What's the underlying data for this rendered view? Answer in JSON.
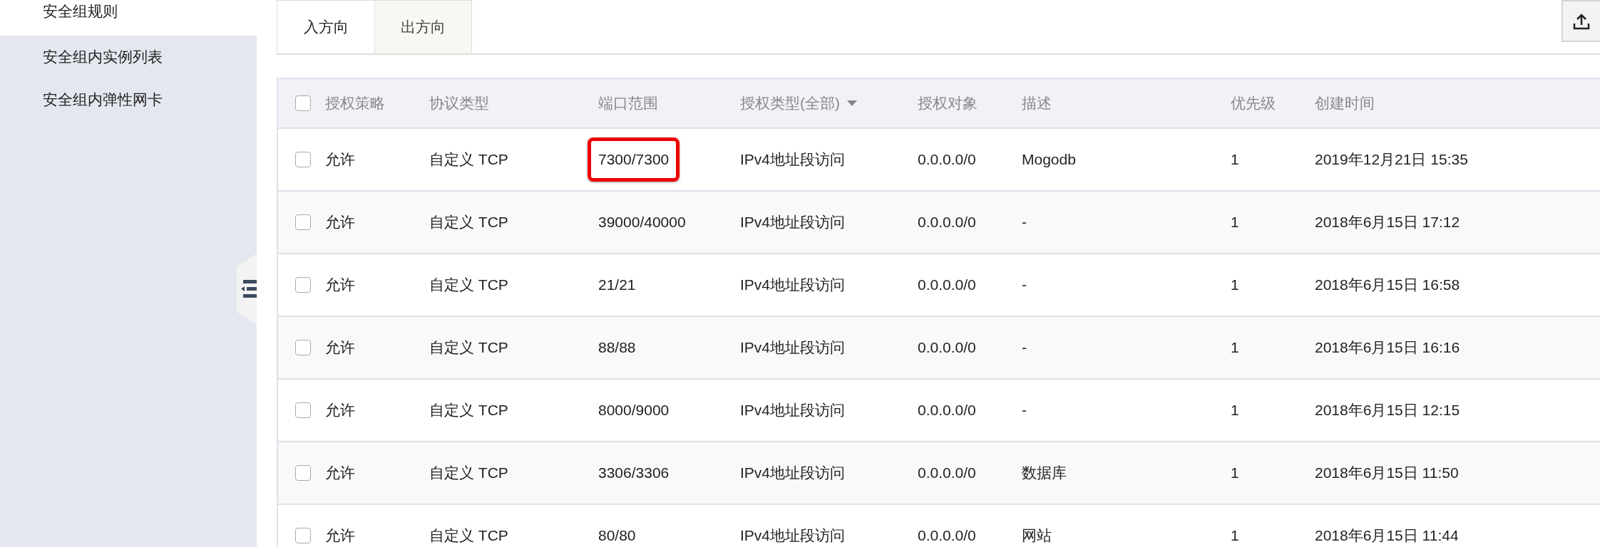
{
  "sidebar": {
    "items": [
      {
        "label": "安全组规则",
        "selected": true
      },
      {
        "label": "安全组内实例列表",
        "selected": false
      },
      {
        "label": "安全组内弹性网卡",
        "selected": false
      }
    ]
  },
  "tabs": [
    {
      "label": "入方向",
      "selected": true
    },
    {
      "label": "出方向",
      "selected": false
    }
  ],
  "table": {
    "columns": [
      "授权策略",
      "协议类型",
      "端口范围",
      "授权类型(全部)",
      "授权对象",
      "描述",
      "优先级",
      "创建时间"
    ],
    "select_all_checked": false,
    "rows": [
      {
        "checked": false,
        "highlighted": true,
        "cells": [
          "允许",
          "自定义 TCP",
          "7300/7300",
          "IPv4地址段访问",
          "0.0.0.0/0",
          "Mogodb",
          "1",
          "2019年12月21日 15:35"
        ]
      },
      {
        "checked": false,
        "highlighted": false,
        "cells": [
          "允许",
          "自定义 TCP",
          "39000/40000",
          "IPv4地址段访问",
          "0.0.0.0/0",
          "-",
          "1",
          "2018年6月15日 17:12"
        ]
      },
      {
        "checked": false,
        "highlighted": false,
        "cells": [
          "允许",
          "自定义 TCP",
          "21/21",
          "IPv4地址段访问",
          "0.0.0.0/0",
          "-",
          "1",
          "2018年6月15日 16:58"
        ]
      },
      {
        "checked": false,
        "highlighted": false,
        "cells": [
          "允许",
          "自定义 TCP",
          "88/88",
          "IPv4地址段访问",
          "0.0.0.0/0",
          "-",
          "1",
          "2018年6月15日 16:16"
        ]
      },
      {
        "checked": false,
        "highlighted": false,
        "cells": [
          "允许",
          "自定义 TCP",
          "8000/9000",
          "IPv4地址段访问",
          "0.0.0.0/0",
          "-",
          "1",
          "2018年6月15日 12:15"
        ]
      },
      {
        "checked": false,
        "highlighted": false,
        "cells": [
          "允许",
          "自定义 TCP",
          "3306/3306",
          "IPv4地址段访问",
          "0.0.0.0/0",
          "数据库",
          "1",
          "2018年6月15日 11:50"
        ]
      },
      {
        "checked": false,
        "highlighted": false,
        "cells": [
          "允许",
          "自定义 TCP",
          "80/80",
          "IPv4地址段访问",
          "0.0.0.0/0",
          "网站",
          "1",
          "2018年6月15日 11:44"
        ]
      }
    ]
  }
}
